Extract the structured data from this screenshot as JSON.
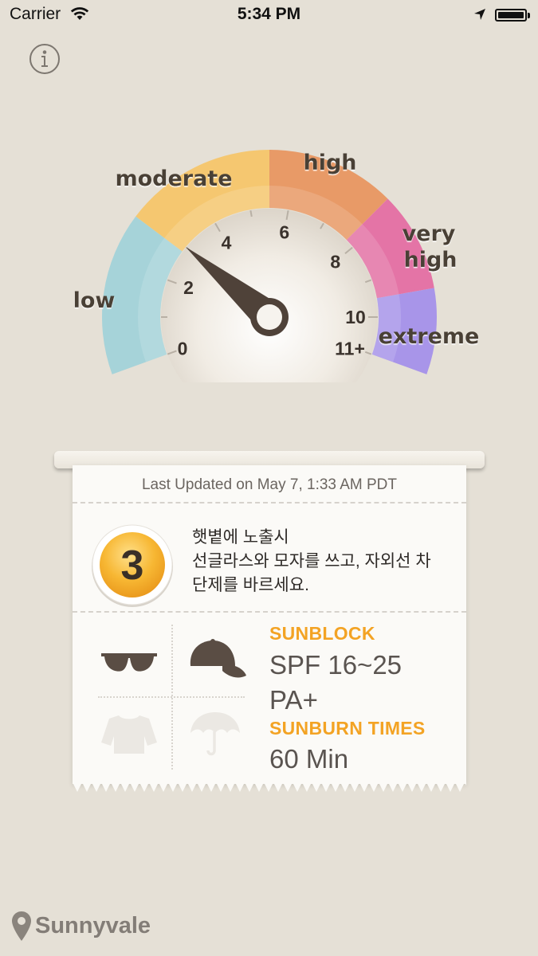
{
  "status_bar": {
    "carrier": "Carrier",
    "time": "5:34 PM"
  },
  "gauge": {
    "categories": {
      "low": "low",
      "moderate": "moderate",
      "high": "high",
      "very_high_line1": "very",
      "very_high_line2": "high",
      "extreme": "extreme"
    },
    "ticks": [
      "0",
      "2",
      "4",
      "6",
      "8",
      "10",
      "11+"
    ],
    "needle_value": 3,
    "colors": {
      "low": "#a6d3d9",
      "moderate": "#f5c770",
      "high": "#e89a67",
      "very_high": "#e474a6",
      "extreme": "#a895e9"
    }
  },
  "card": {
    "last_updated": "Last Updated on May 7, 1:33 AM PDT",
    "uv_index": "3",
    "advice_line1": "햇볕에 노출시",
    "advice_line2": "선글라스와 모자를 쓰고, 자외선 차",
    "advice_line3": "단제를 바르세요.",
    "sunblock_label": "SUNBLOCK",
    "spf_value": "SPF 16~25",
    "pa_value": "PA+",
    "sunburn_label": "SUNBURN TIMES",
    "sunburn_value": "60 Min",
    "accent_color": "#f3a324"
  },
  "location": {
    "name": "Sunnyvale"
  }
}
